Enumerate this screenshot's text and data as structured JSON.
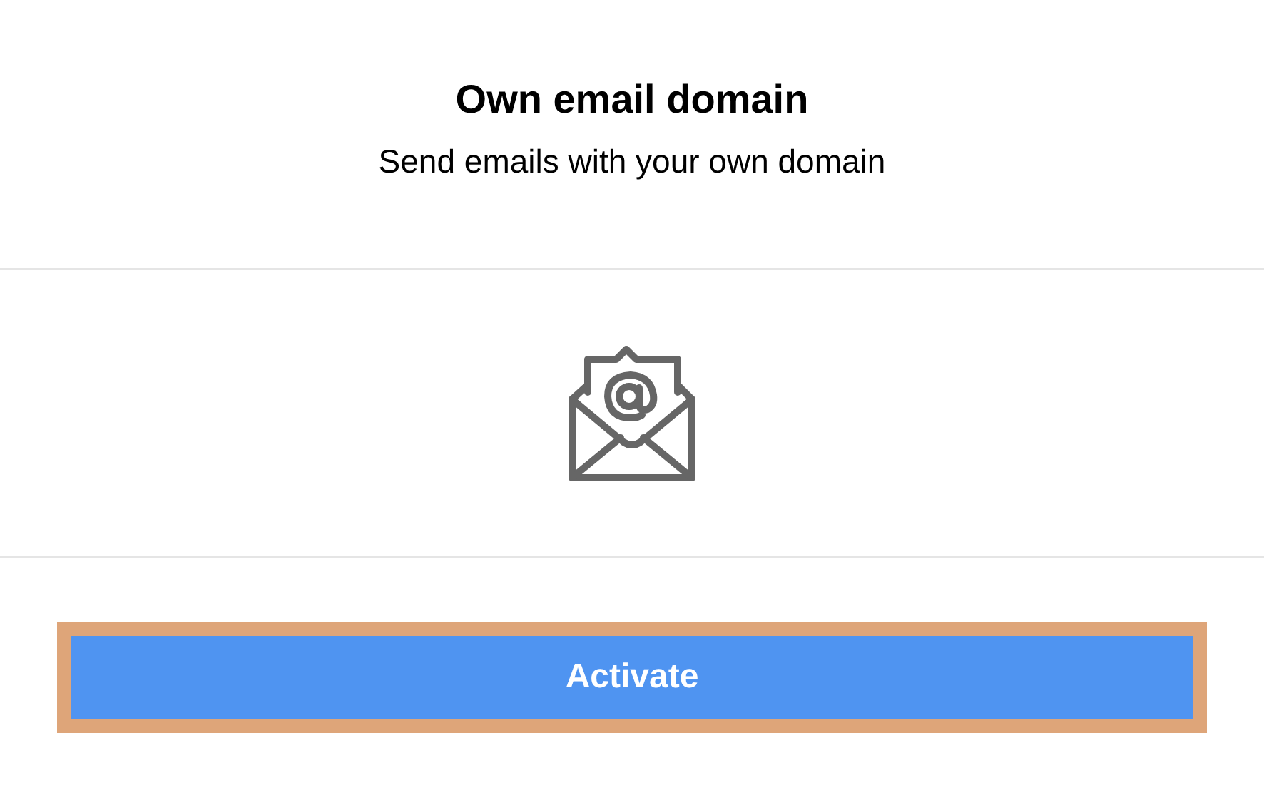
{
  "title": "Own email domain",
  "subtitle": "Send emails with your own domain",
  "button": {
    "label": "Activate",
    "highlighted": true
  }
}
